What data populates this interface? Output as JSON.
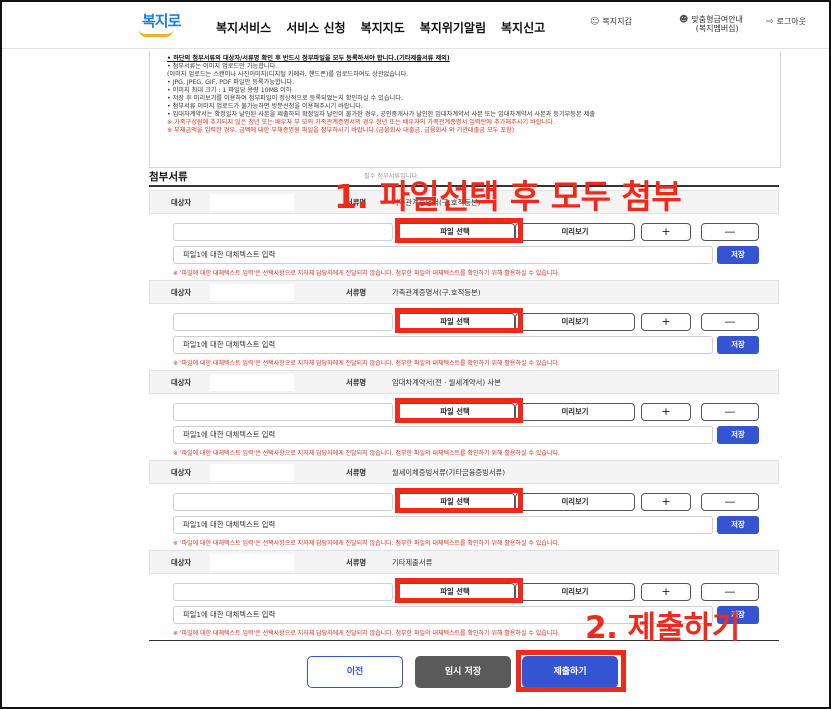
{
  "header": {
    "logo": "복지로",
    "nav": [
      "복지서비스",
      "서비스 신청",
      "복지지도",
      "복지위기알림",
      "복지신고"
    ],
    "util": {
      "wallet_icon": "person-icon",
      "wallet": "복지지갑",
      "custom_icon": "user-plus-icon",
      "custom_line1": "맞춤형급여안내",
      "custom_line2": "(복지멤버십)",
      "logout_icon": "logout-icon",
      "logout": "로그아웃"
    }
  },
  "notes": [
    "• 하단의 첨부서류의 대상자/서류명 확인 후 반드시 첨부파일을 모두 등록하셔야 합니다.(기타제출서류 제외)",
    "• 첨부서류는 이미지 업로드만 가능합니다.",
    "  (이미지 업로드는 스캔이나 사진이미지(디지털 카메라, 핸드폰)를 업로드하여도 상관없습니다.",
    "• JPG, JPEG, GIF, PDF 파일만 등록가능합니다.",
    "• 이미지 최대 크기 : 1 파일당 용량 10MB 이하",
    "• 저장 후 미리보기를 이용하여 첨부파일이 정상적으로 등록되었는지 확인하실 수 있습니다.",
    "• 첨부서류 이미지 업로드가 불가능하면 방문신청을 이용해주시기 바랍니다.",
    "• 임대차계약서는 확정일자 날인된 사본을 제출하되 확정일자 날인이 불가한 경우, 공인중개사가 날인한 임대차계약서 사본 또는 임대차계약서 사본과 등기부등본 제출",
    "  ※ 가족구성원에 추가되지 않은 청년 또는 배우자 부 모의 가족관계증명서의 경우 청년 또는 배우자의 가족관계증명서 입력란에 추가해주시기 바랍니다.",
    "  ※ 부채금액을 입력한 경우, 금액에 대한 부채증명원 파일을 첨부하시기 바랍니다.(금융회사 대출금, 금융회사 외 기관대출금 모두 포함)"
  ],
  "section": {
    "title": "첨부서류",
    "subtitle": "필수 첨부서류입니다."
  },
  "labels": {
    "target": "대상자",
    "doc_name": "서류명",
    "select_file": "파일 선택",
    "preview": "미리보기",
    "plus": "+",
    "minus": "—",
    "alt_text": "파일1에 대한 대체텍스트 입력",
    "save": "저장",
    "warning": "※ '파일에 대한 대체텍스트 입력'은 선택사항으로 지자체 담당자에게 전달되지 않습니다. 첨부한 파일의 대체텍스트를 확인하기 위해 활용하실 수 있습니다."
  },
  "documents": [
    {
      "name": "가족관계증명서(구.호적등본)"
    },
    {
      "name": "가족관계증명서(구.호적등본)"
    },
    {
      "name": "임대차계약서(전 · 월세계약서) 사본"
    },
    {
      "name": "월세이체증빙서류(기타금융증빙서류)"
    },
    {
      "name": "기타제출서류"
    }
  ],
  "buttons": {
    "prev": "이전",
    "temp_save": "임시 저장",
    "submit": "제출하기"
  },
  "annotations": {
    "step1": "1. 파일선택 후 모두 첨부",
    "step2": "2. 제출하기"
  },
  "colors": {
    "primary": "#3454d1",
    "annotation": "#f02a1a",
    "logo": "#1c7fd9"
  }
}
